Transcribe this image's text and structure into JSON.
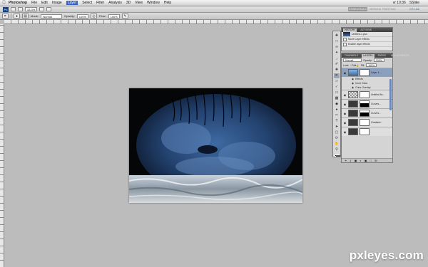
{
  "menubar": {
    "app": "Photoshop",
    "items": [
      "File",
      "Edit",
      "Image",
      "Layer",
      "Select",
      "Filter",
      "Analysis",
      "3D",
      "View",
      "Window",
      "Help"
    ],
    "active": "Layer",
    "clock": "vr 10:36",
    "user": "SSlike"
  },
  "appbar": {
    "logo": "Ps",
    "zoom": "33,3%",
    "workspaces": [
      "ESSENTIALS",
      "DESIGN",
      "PAINTING",
      "CS Live"
    ]
  },
  "options": {
    "mode_label": "Mode:",
    "mode_value": "Normal",
    "opacity_label": "Opacity:",
    "opacity_value": "100%",
    "flow_label": "Flow:",
    "flow_value": "100%"
  },
  "history": {
    "tabs": [
      "HISTORY",
      "ACTIONS"
    ],
    "rows": [
      "Untitled-1.psd",
      "Move Layer Effects",
      "Enable layer effects"
    ]
  },
  "layers": {
    "tabs": [
      "CHANNELS",
      "LAYERS",
      "PATHS",
      "ADJUSTMENTS"
    ],
    "blend_mode": "Normal",
    "opacity_label": "Opacity:",
    "opacity_value": "100%",
    "lock_label": "Lock:",
    "fill_label": "Fill:",
    "fill_value": "100%",
    "rows": [
      {
        "name": "Layer 1...",
        "kind": "image"
      },
      {
        "name": "Effects",
        "kind": "sub"
      },
      {
        "name": "Inner Glow",
        "kind": "sub"
      },
      {
        "name": "Color Overlay",
        "kind": "sub"
      },
      {
        "name": "Untitled-fix...",
        "kind": "image"
      },
      {
        "name": "Curves...",
        "kind": "adjust"
      },
      {
        "name": "Curves...",
        "kind": "adjust"
      },
      {
        "name": "Gradient...",
        "kind": "adjust"
      },
      {
        "name": "",
        "kind": "adjust"
      }
    ]
  },
  "watermark": "pxleyes.com",
  "colors": {
    "workspace_bg": "#bdbdbd",
    "selection": "#8aa0be",
    "watermark": "#ffffff"
  }
}
